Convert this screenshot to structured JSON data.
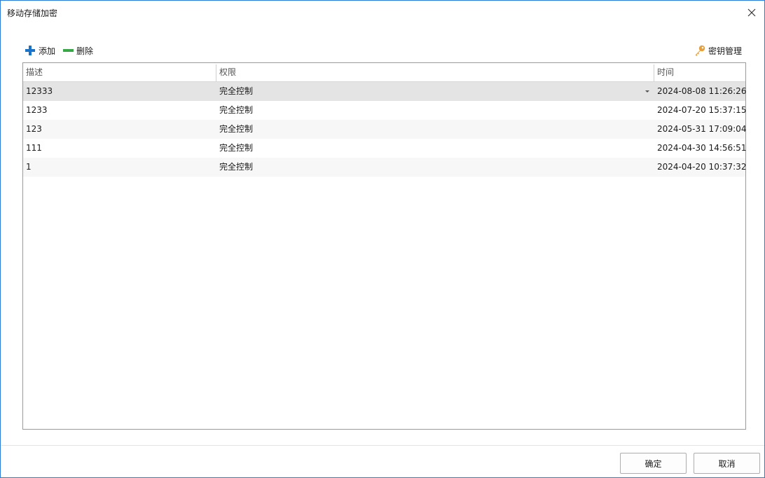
{
  "window": {
    "title": "移动存储加密"
  },
  "toolbar": {
    "add_label": "添加",
    "delete_label": "删除",
    "key_management_label": "密钥管理"
  },
  "table": {
    "columns": [
      "描述",
      "权限",
      "时间"
    ],
    "rows": [
      {
        "desc": "12333",
        "perm": "完全控制",
        "time": "2024-08-08 11:26:26",
        "selected": true
      },
      {
        "desc": "1233",
        "perm": "完全控制",
        "time": "2024-07-20 15:37:15"
      },
      {
        "desc": "123",
        "perm": "完全控制",
        "time": "2024-05-31 17:09:04"
      },
      {
        "desc": "111",
        "perm": "完全控制",
        "time": "2024-04-30 14:56:51"
      },
      {
        "desc": "1",
        "perm": "完全控制",
        "time": "2024-04-20 10:37:32"
      }
    ]
  },
  "buttons": {
    "ok_label": "确定",
    "cancel_label": "取消"
  },
  "colors": {
    "accent_add": "#1a73c9",
    "accent_delete": "#3aa64a",
    "key_icon": "#e8a13a",
    "window_border": "#2b7bd8"
  },
  "icons": {
    "add": "plus-icon",
    "delete": "minus-icon",
    "key_management": "key-icon",
    "close": "close-icon"
  }
}
